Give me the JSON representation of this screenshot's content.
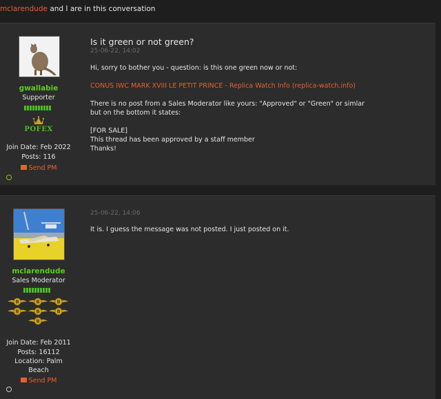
{
  "conversation": {
    "participant": "mclarendude",
    "participants_text": " and I are in this conversation"
  },
  "posts": [
    {
      "username": "gwallabie",
      "user_title": "Supporter",
      "badge_text": "POFEX",
      "join_date": "Join Date: Feb 2022",
      "posts_count": "Posts: 116",
      "send_pm": "Send PM",
      "title": "Is it green or not green?",
      "date": "25-06-22, 14:02",
      "lines": {
        "l1": "Hi, sorry to bother you - question: is this one green now or not:",
        "link": "CONUS IWC MARK XVIII LE PETIT PRINCE - Replica Watch Info (replica-watch.info)",
        "l3": "There is no post from a Sales Moderator like yours: \"Approved\" or \"Green\" or simlar",
        "l4": "but on the bottom it states:",
        "l5": "[FOR SALE]",
        "l6": "This thread has been approved by a staff member",
        "l7": "Thanks!"
      }
    },
    {
      "username": "mclarendude",
      "user_title": "Sales Moderator",
      "join_date": "Join Date: Feb 2011",
      "posts_count": "Posts: 16112",
      "location_1": "Location: Palm",
      "location_2": "Beach",
      "send_pm": "Send PM",
      "date": "25-06-22, 14:06",
      "body": "It is. I guess the message was not posted. I just posted on it."
    }
  ],
  "colors": {
    "accent": "#e8602c",
    "username_green": "#5ecb1c",
    "gold": "#c9a227",
    "online": "#8fc31f"
  }
}
